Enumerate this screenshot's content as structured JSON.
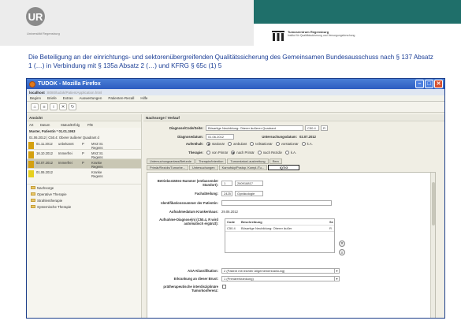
{
  "slide": {
    "university_name": "Universität Regensburg",
    "partner_title": "Tumorzentrum Regensburg",
    "partner_subtitle": "Institut für Qualitätssicherung und Versorgungsforschung",
    "body_text": "Die Beteiligung an der einrichtungs- und sektorenübergreifenden Qualitätssicherung des Gemeinsamen Bundesausschuss nach § 137 Absatz 1 (…) in Verbindung mit § 135a Absatz 2 (…) und KFRG § 65c (1) 5",
    "colors": {
      "brand_teal": "#1f6f6a",
      "text_blue": "#1b3e96"
    }
  },
  "browser": {
    "title": "TUDOK - Mozilla Firefox",
    "url_host": "localhost",
    "url_path": ":8080/tudok/PatientApplication.html",
    "menu": [
      "Beginn",
      "Briefe",
      "Extras",
      "Auswertungen",
      "Patienten-Recall",
      "Hilfe"
    ],
    "toolbar_icons": [
      "home-icon",
      "list-icon",
      "info-icon",
      "close-icon",
      "refresh-icon"
    ]
  },
  "left_panel": {
    "header": "Ansicht",
    "columns": [
      "Art",
      "Datum",
      "Status/Erfolg",
      "P/B"
    ],
    "patient_label": "Muster, Patientin * 01.01.1953",
    "case_label": "01.06.2012 | C50.4: Oberer äußerer Quadrant d",
    "rows": [
      {
        "date": "01.11.2012",
        "status": "unbekannt",
        "pb": "P",
        "desc1": "MVZ St.",
        "desc2": "Regens",
        "flag": "#d4a010"
      },
      {
        "date": "16.10.2012",
        "status": "Immerfrei",
        "pb": "P",
        "desc1": "MVZ St.",
        "desc2": "Regens",
        "flag": "#d4a010"
      },
      {
        "date": "02.07.2012",
        "status": "Immerfrei",
        "pb": "P",
        "desc1": "Kranke",
        "desc2": "Regens",
        "flag": "#d4a010"
      },
      {
        "date": "01.06.2012",
        "status": "",
        "pb": "",
        "desc1": "Kranke",
        "desc2": "Regens",
        "flag": "#e7d020"
      }
    ],
    "tree_items": [
      "Nachsorge",
      "Operative Therapie",
      "Strahlentherapie",
      "Systemische Therapie"
    ]
  },
  "right_panel": {
    "header": "Nachsorge / Verlauf",
    "diagnose_label": "Diagnose/Code/Seite:",
    "diagnose_value": "Bösartige Neubildung: Oberer äußerer Quadrant",
    "diagnose_code": "C50.4",
    "diagnose_side": "R",
    "diagnosedatum_label": "Diagnosedatum:",
    "diagnosedatum_value": "01.06.2012",
    "untersuchung_label": "Untersuchungsdatum:",
    "untersuchung_value": "02.07.2012",
    "aufenthalt_label": "Aufenthalt:",
    "aufenthalt_options": [
      "stationär",
      "ambulant",
      "teilstationär",
      "vorstationär",
      "k.A."
    ],
    "therapie_label": "Therapie:",
    "therapie_options": [
      "von Primär",
      "nach Primär",
      "nach Rezidiv",
      "k.A."
    ],
    "tabs_row1": [
      "Untersuchungsanlass/Befunde",
      "Therapie/Intention",
      "Tumorstatus/-ausbreitung",
      "Rem"
    ],
    "tabs_row2": [
      "Primär/Rezidiv/Tumorbe...",
      "Untersuchungen",
      "Karnofsky/Postop. Kompl./Tu...",
      "IQTIG"
    ],
    "betriebsstaetten_label": "Betriebsstätten-Nummer (entlassender Standort):",
    "betriebsstaetten_value1": "1",
    "betriebsstaetten_value2": "260918817",
    "fachabteilung_label": "Fachabteilung:",
    "fachabteilung_code": "2425",
    "fachabteilung_value": "Gynäkologie",
    "identifikation_label": "Identifikationsnummer der Patientin:",
    "aufnahme_label": "Aufnahmedatum Krankenhaus:",
    "aufnahme_value": "29.06.2012",
    "aufnahmediagnose_label": "Aufnahme-Diagnose(n) (C50.4, R wird automatisch ergänzt):",
    "diag_table_headers": [
      "Code",
      "Beschreibung",
      "Se"
    ],
    "diag_table_rows": [
      {
        "code": "C50.4",
        "desc": "Bösartige Neubildung: Oberer äußer",
        "side": "R"
      }
    ],
    "asa_label": "ASA-Klassifikation:",
    "asa_value": "2 (Patient mit leichter Allgemeinerkrankung)",
    "eingriff_label": "Erkrankung an dieser Brust:",
    "eingriff_value": "1 (Primärerkrankung)",
    "praeop_label": "prätherapeutische interdisziplinäre Tumorkonferenz:"
  }
}
